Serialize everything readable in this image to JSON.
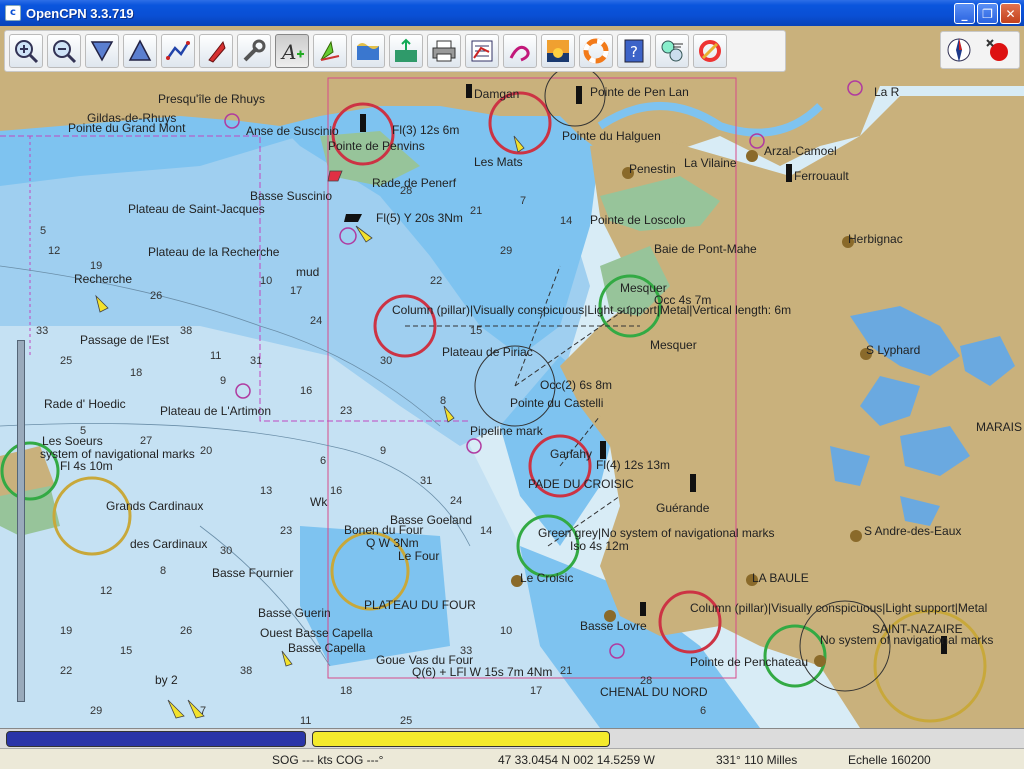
{
  "window": {
    "title": "OpenCPN 3.3.719",
    "minimize": "_",
    "maximize": "❐",
    "close": "✕"
  },
  "toolbar": {
    "buttons": [
      {
        "icon": "zoom-in-icon"
      },
      {
        "icon": "zoom-out-icon"
      },
      {
        "icon": "scale-down-icon"
      },
      {
        "icon": "scale-up-icon"
      },
      {
        "icon": "route-icon"
      },
      {
        "icon": "mob-boat-icon"
      },
      {
        "icon": "settings-wrench-icon"
      },
      {
        "icon": "text-font-icon"
      },
      {
        "icon": "current-icon"
      },
      {
        "icon": "tide-icon"
      },
      {
        "icon": "tide-current-icon"
      },
      {
        "icon": "print-icon"
      },
      {
        "icon": "route-manager-icon"
      },
      {
        "icon": "track-icon"
      },
      {
        "icon": "color-scheme-icon"
      },
      {
        "icon": "lifebuoy-icon"
      },
      {
        "icon": "help-icon"
      },
      {
        "icon": "grib-icon"
      },
      {
        "icon": "mob-icon"
      }
    ]
  },
  "map": {
    "colors": {
      "land": "#c9b17c",
      "deep_water": "#d8ecf6",
      "shallow_water": "#7ec3f0",
      "mid_water": "#b5d7ef",
      "drying": "#97c49a",
      "limit_line": "#d84a8a"
    },
    "place_labels": [
      {
        "text": "Presqu'île de Rhuys"
      },
      {
        "text": "Gildas-de-Rhuys"
      },
      {
        "text": "Pointe du Grand Mont"
      },
      {
        "text": "Anse de Suscinio"
      },
      {
        "text": "Pointe de Penvins"
      },
      {
        "text": "Damgan"
      },
      {
        "text": "Pointe de Pen Lan"
      },
      {
        "text": "Pointe du Halguen"
      },
      {
        "text": "La Vilaine"
      },
      {
        "text": "Arzal-Camoel"
      },
      {
        "text": "Ferrouault"
      },
      {
        "text": "Penestin"
      },
      {
        "text": "La R"
      },
      {
        "text": "Rade de Penerf"
      },
      {
        "text": "Basse Suscinio"
      },
      {
        "text": "Plateau de Saint-Jacques"
      },
      {
        "text": "Les Mats"
      },
      {
        "text": "Pointe de Loscolo"
      },
      {
        "text": "Baie de Pont-Mahe"
      },
      {
        "text": "Herbignac"
      },
      {
        "text": "Plateau de la Recherche"
      },
      {
        "text": "Recherche"
      },
      {
        "text": "mud"
      },
      {
        "text": "Mesquer"
      },
      {
        "text": "Mesquer"
      },
      {
        "text": "Passage de l'Est"
      },
      {
        "text": "Plateau de Piriac"
      },
      {
        "text": "S Lyphard"
      },
      {
        "text": "Rade d' Hoedic"
      },
      {
        "text": "Plateau de L'Artimon"
      },
      {
        "text": "Pointe du Castelli"
      },
      {
        "text": "Pipeline mark"
      },
      {
        "text": "MARAIS"
      },
      {
        "text": "Les Soeurs"
      },
      {
        "text": "Garlahy"
      },
      {
        "text": "PADE DU CROISIC"
      },
      {
        "text": "Grands Cardinaux"
      },
      {
        "text": "Guérande"
      },
      {
        "text": "Basse Goeland"
      },
      {
        "text": "S Andre-des-Eaux"
      },
      {
        "text": "des Cardinaux"
      },
      {
        "text": "Basse Fournier"
      },
      {
        "text": "Le Croisic"
      },
      {
        "text": "PLATEAU DU FOUR"
      },
      {
        "text": "LA BAULE"
      },
      {
        "text": "Basse Lovre"
      },
      {
        "text": "Basse Guerin"
      },
      {
        "text": "Ouest Basse Capella"
      },
      {
        "text": "Basse Capella"
      },
      {
        "text": "Goue Vas du Four"
      },
      {
        "text": "Pointe de Penchateau"
      },
      {
        "text": "SAINT-NAZAIRE"
      },
      {
        "text": "CHENAL DU NORD"
      },
      {
        "text": "Wk"
      }
    ],
    "light_labels": [
      {
        "text": "Fl(3) 12s 6m"
      },
      {
        "text": "Fl(5) Y 20s 3Nm"
      },
      {
        "text": "Q(6) + LFl W 15s 7m 4Nm"
      },
      {
        "text": "Occ 4s 7m"
      },
      {
        "text": "Occ(2) 6s 8m"
      },
      {
        "text": "Fl(4) 12s 13m"
      },
      {
        "text": "Q W 3Nm"
      },
      {
        "text": "Fl 4s 10m"
      },
      {
        "text": "Iso 4s 12m"
      },
      {
        "text": "system of navigational marks"
      },
      {
        "text": "Column (pillar)|Visually conspicuous|Light support|Metal|Vertical length: 6m"
      },
      {
        "text": "Green grey|No system of navigational marks"
      },
      {
        "text": "Column (pillar)|Visually conspicuous|Light support|Metal"
      },
      {
        "text": "No system of navigational marks"
      },
      {
        "text": "Le Four"
      },
      {
        "text": "Bonen du Four"
      },
      {
        "text": "by 2"
      }
    ],
    "depths": [
      "5",
      "6",
      "7",
      "8",
      "9",
      "10",
      "11",
      "12",
      "13",
      "14",
      "15",
      "16",
      "17",
      "18",
      "19",
      "20",
      "21",
      "22",
      "23",
      "24",
      "25",
      "26",
      "27",
      "28",
      "29",
      "30",
      "31",
      "33",
      "38"
    ]
  },
  "piano": {
    "keys": [
      {
        "color": "#2a34a8"
      },
      {
        "color": "#f4ea2c"
      }
    ]
  },
  "status": {
    "sog_cog": "SOG --- kts COG ---°",
    "position": "47 33.0454 N   002 14.5259 W",
    "bearing_distance": "331°  110 Milles",
    "scale": "Echelle 160200"
  }
}
